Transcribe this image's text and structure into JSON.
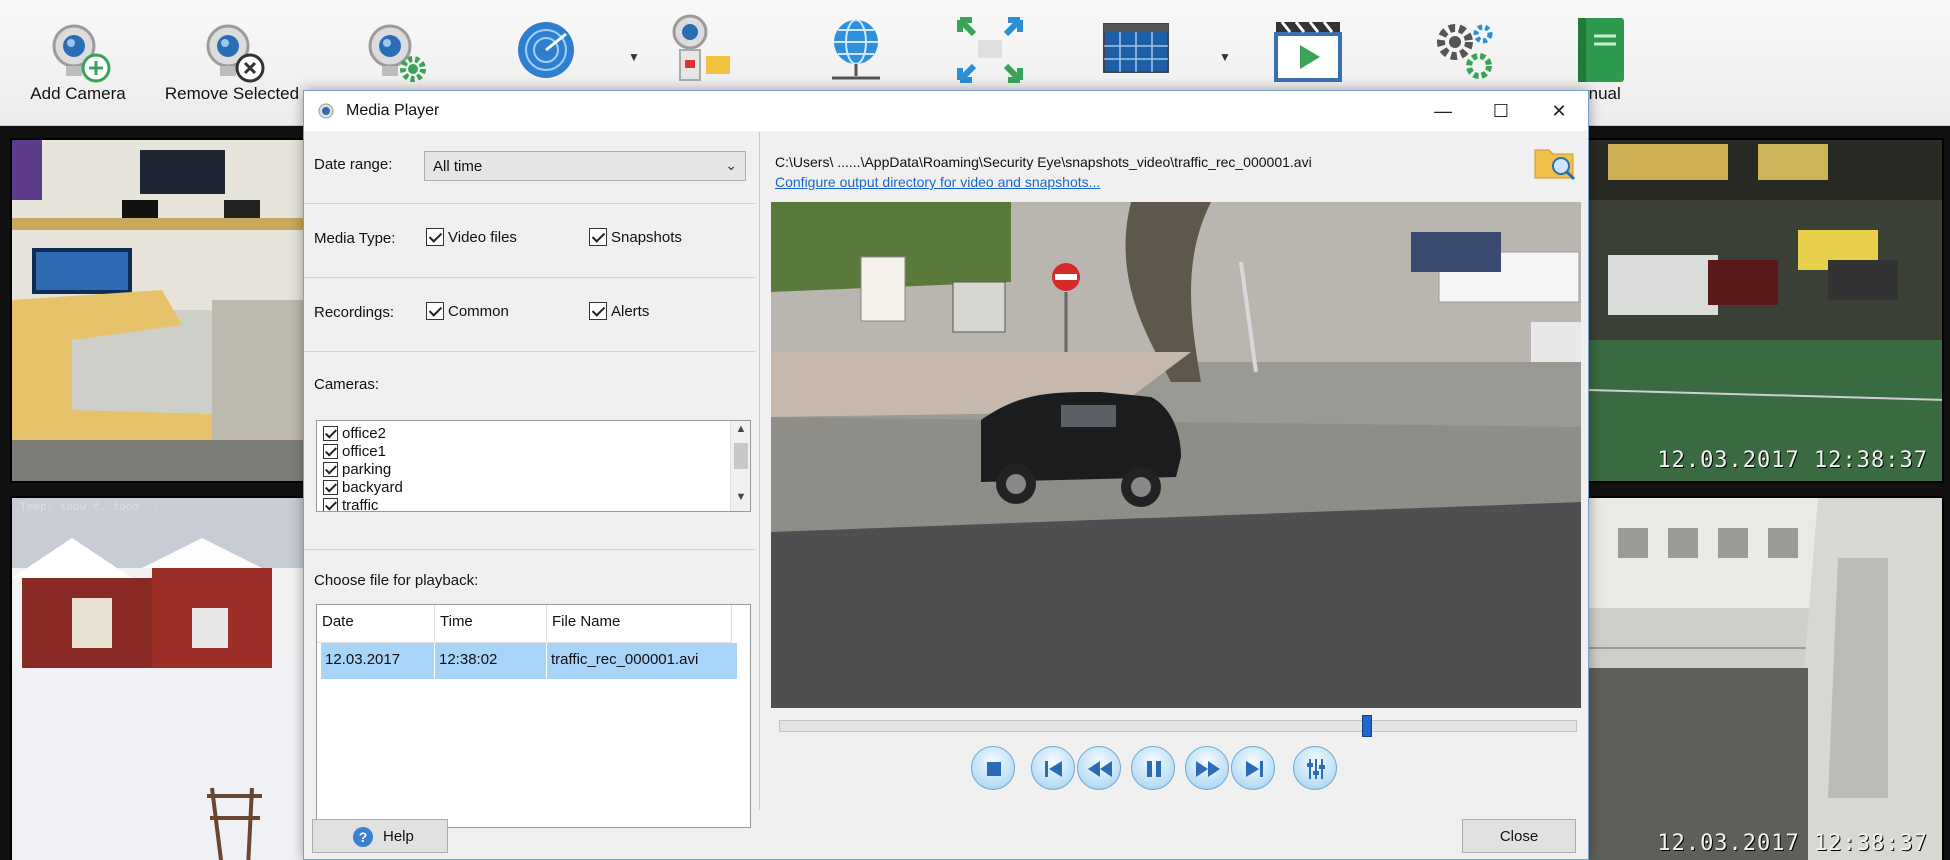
{
  "toolbar": {
    "buttons": [
      {
        "label": "Add Camera",
        "icon": "add-camera-icon"
      },
      {
        "label": "Remove Selected",
        "icon": "remove-camera-icon"
      },
      {
        "label": "",
        "icon": "camera-settings-icon"
      },
      {
        "label": "",
        "icon": "radar-icon"
      },
      {
        "label": "",
        "icon": "record-icon"
      },
      {
        "label": "",
        "icon": "network-icon"
      },
      {
        "label": "",
        "icon": "fullscreen-icon"
      },
      {
        "label": "",
        "icon": "layout-icon"
      },
      {
        "label": "",
        "icon": "media-player-icon"
      },
      {
        "label": "",
        "icon": "settings-icon"
      },
      {
        "label": "anual",
        "icon": "manual-book-icon"
      }
    ]
  },
  "cameras": {
    "stamps": [
      "12.03.2017  12:38:37",
      "12.03.2017  12:38:37"
    ],
    "top_stamp": "Temp: snow f.  food  ..."
  },
  "window": {
    "title": "Media Player",
    "controls": {
      "minimize": "—",
      "maximize": "☐",
      "close": "✕"
    }
  },
  "filters": {
    "date_range_label": "Date range:",
    "date_range_value": "All time",
    "media_type_label": "Media Type:",
    "video_files": "Video files",
    "snapshots": "Snapshots",
    "recordings_label": "Recordings:",
    "common": "Common",
    "alerts": "Alerts",
    "cameras_label": "Cameras:",
    "camera_list": [
      "office2",
      "office1",
      "parking",
      "backyard",
      "traffic"
    ]
  },
  "playback": {
    "choose_label": "Choose file for playback:",
    "columns": [
      "Date",
      "Time",
      "File Name"
    ],
    "rows": [
      {
        "date": "12.03.2017",
        "time": "12:38:02",
        "file": "traffic_rec_000001.avi"
      }
    ],
    "path": "C:\\Users\\ ......\\AppData\\Roaming\\Security Eye\\snapshots_video\\traffic_rec_000001.avi",
    "config_link": "Configure output directory for video and snapshots...",
    "seek_position": 0.74
  },
  "footer": {
    "help": "Help",
    "close": "Close"
  },
  "colors": {
    "accent": "#1a66c9",
    "selection": "#a8d4f8",
    "window_border": "#7a9fc8"
  }
}
